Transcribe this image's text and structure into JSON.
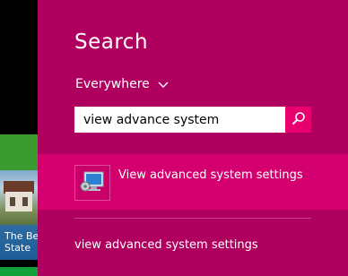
{
  "start_screen": {
    "tile_caption": "The Be\nState"
  },
  "search": {
    "title": "Search",
    "scope": {
      "label": "Everywhere",
      "icon": "chevron-down-icon"
    },
    "input": {
      "value": "view advance system",
      "icon": "search-icon"
    },
    "results": {
      "app_result": {
        "label": "View advanced system settings",
        "icon": "system-properties-icon"
      },
      "web_suggestion": {
        "label": "view advanced system settings"
      }
    }
  },
  "colors": {
    "pane_bg": "#b0005f",
    "selected_bg": "#d5006f",
    "search_button_bg": "#e8006e"
  }
}
